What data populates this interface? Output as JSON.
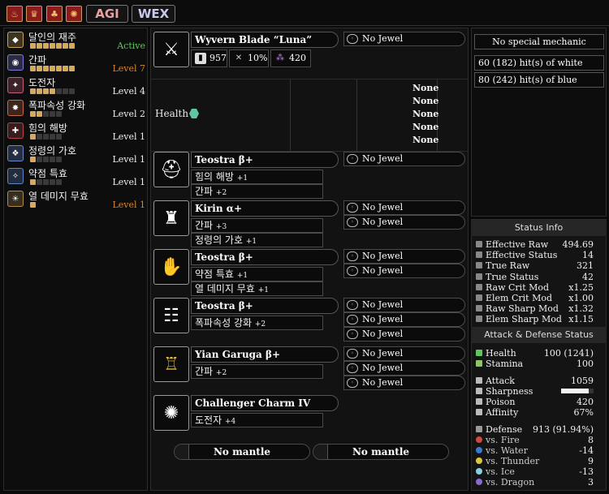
{
  "topbar": {
    "icons": [
      "fire-icon",
      "crown-icon",
      "flame-icon",
      "sun-icon"
    ],
    "agi_label": "AGI",
    "wex_label": "WEX",
    "colors": {
      "agi_text": "#e8a0a0",
      "wex_text": "#c8c8f0"
    }
  },
  "skills": [
    {
      "name": "달인의 재주",
      "level": "Active",
      "level_color": "green",
      "pips_on": 7,
      "pips_total": 7,
      "icon": "gem-icon"
    },
    {
      "name": "간파",
      "level": "Level 7",
      "level_color": "orange",
      "pips_on": 7,
      "pips_total": 7,
      "icon": "eye-icon"
    },
    {
      "name": "도전자",
      "level": "Level 4",
      "level_color": "white",
      "pips_on": 4,
      "pips_total": 7,
      "icon": "challenger-icon"
    },
    {
      "name": "폭파속성 강화",
      "level": "Level 2",
      "level_color": "white",
      "pips_on": 2,
      "pips_total": 5,
      "icon": "blast-icon"
    },
    {
      "name": "힘의 해방",
      "level": "Level 1",
      "level_color": "white",
      "pips_on": 1,
      "pips_total": 5,
      "icon": "power-icon"
    },
    {
      "name": "정령의 가호",
      "level": "Level 1",
      "level_color": "white",
      "pips_on": 1,
      "pips_total": 5,
      "icon": "spirit-icon"
    },
    {
      "name": "약점 특효",
      "level": "Level 1",
      "level_color": "white",
      "pips_on": 1,
      "pips_total": 5,
      "icon": "weakness-icon"
    },
    {
      "name": "열 데미지 무효",
      "level": "Level 1",
      "level_color": "orange",
      "pips_on": 1,
      "pips_total": 1,
      "icon": "heat-icon"
    }
  ],
  "weapon": {
    "name": "Wyvern Blade “Luna”",
    "attack": "957",
    "affinity": "10%",
    "element": "420",
    "jewel": "No Jewel",
    "health_label": "Health",
    "none_rows": [
      "None",
      "None",
      "None",
      "None",
      "None"
    ]
  },
  "armor": [
    {
      "name": "Teostra β+",
      "skills": [
        {
          "name": "힘의 해방",
          "lv": "+1"
        },
        {
          "name": "간파",
          "lv": "+2"
        }
      ],
      "jewels": [
        "No Jewel"
      ],
      "icon": "helmet-icon"
    },
    {
      "name": "Kirin α+",
      "skills": [
        {
          "name": "간파",
          "lv": "+3"
        },
        {
          "name": "정령의 가호",
          "lv": "+1"
        }
      ],
      "jewels": [
        "No Jewel",
        "No Jewel"
      ],
      "icon": "chest-icon"
    },
    {
      "name": "Teostra β+",
      "skills": [
        {
          "name": "약점 특효",
          "lv": "+1"
        },
        {
          "name": "열 데미지 무효",
          "lv": "+1"
        }
      ],
      "jewels": [
        "No Jewel",
        "No Jewel"
      ],
      "icon": "arms-icon"
    },
    {
      "name": "Teostra β+",
      "skills": [
        {
          "name": "폭파속성 강화",
          "lv": "+2"
        }
      ],
      "jewels": [
        "No Jewel",
        "No Jewel",
        "No Jewel"
      ],
      "icon": "waist-icon"
    },
    {
      "name": "Yian Garuga β+",
      "skills": [
        {
          "name": "간파",
          "lv": "+2"
        }
      ],
      "jewels": [
        "No Jewel",
        "No Jewel",
        "No Jewel"
      ],
      "icon": "legs-icon"
    },
    {
      "name": "Challenger Charm IV",
      "skills": [
        {
          "name": "도전자",
          "lv": "+4"
        }
      ],
      "jewels": [],
      "icon": "charm-icon"
    }
  ],
  "mantles": [
    "No mantle",
    "No mantle"
  ],
  "mechanics": {
    "special": "No special mechanic",
    "white_hits": "60 (182) hit(s) of white",
    "blue_hits": "80 (242) hit(s) of blue"
  },
  "status_info": {
    "title": "Status Info",
    "rows": [
      {
        "label": "Effective Raw",
        "value": "494.69"
      },
      {
        "label": "Effective Status",
        "value": "14"
      },
      {
        "label": "True Raw",
        "value": "321"
      },
      {
        "label": "True Status",
        "value": "42"
      },
      {
        "label": "Raw Crit Mod",
        "value": "x1.25"
      },
      {
        "label": "Elem Crit Mod",
        "value": "x1.00"
      },
      {
        "label": "Raw Sharp Mod",
        "value": "x1.32"
      },
      {
        "label": "Elem Sharp Mod",
        "value": "x1.15"
      }
    ]
  },
  "attack_defense": {
    "title": "Attack & Defense Status",
    "health": {
      "label": "Health",
      "value": "100 (1241)"
    },
    "stamina": {
      "label": "Stamina",
      "value": "100"
    },
    "attack": {
      "label": "Attack",
      "value": "1059"
    },
    "sharpness": {
      "label": "Sharpness",
      "fill": 0.85
    },
    "poison": {
      "label": "Poison",
      "value": "420"
    },
    "affinity": {
      "label": "Affinity",
      "value": "67%"
    },
    "defense": {
      "label": "Defense",
      "value": "913 (91.94%)"
    },
    "resists": [
      {
        "label": "vs. Fire",
        "value": "8"
      },
      {
        "label": "vs. Water",
        "value": "-14"
      },
      {
        "label": "vs. Thunder",
        "value": "9"
      },
      {
        "label": "vs. Ice",
        "value": "-13"
      },
      {
        "label": "vs. Dragon",
        "value": "3"
      }
    ]
  }
}
